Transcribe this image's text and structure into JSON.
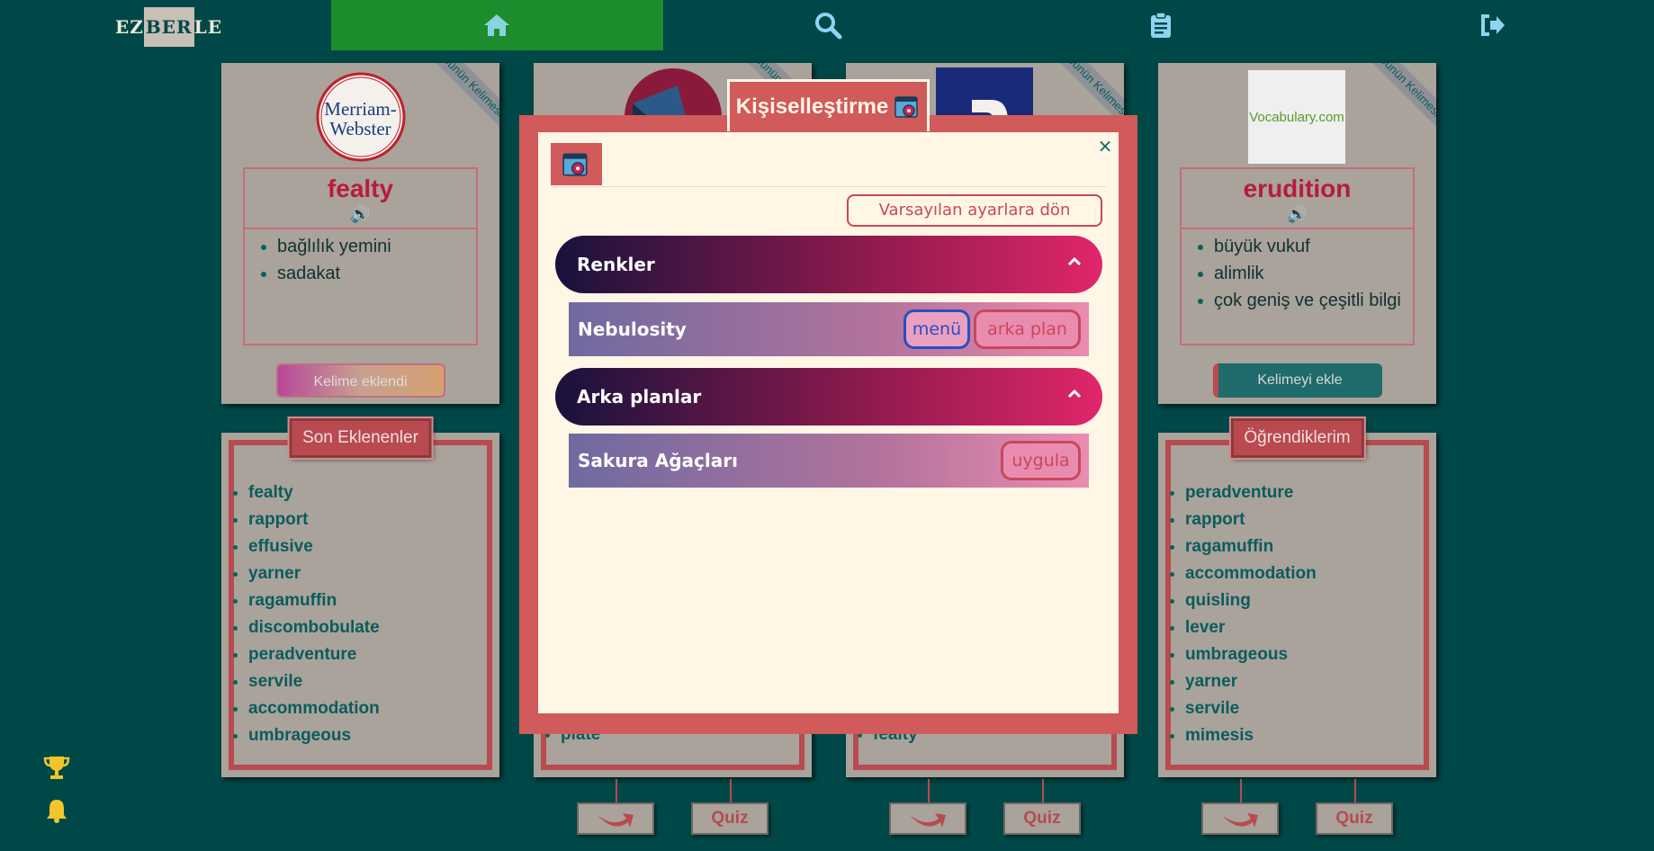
{
  "nav": {
    "logo_left": "EZ",
    "logo_mid": "BER",
    "logo_right": "LE",
    "items": [
      {
        "icon": "home-icon"
      },
      {
        "icon": "search-icon"
      },
      {
        "icon": "clipboard-icon"
      },
      {
        "icon": "sign-out-icon"
      }
    ]
  },
  "cards": {
    "ribbon": "Günün Kelimesi",
    "card1": {
      "logo_text_1": "Merriam-",
      "logo_text_2": "Webster",
      "word": "fealty",
      "definitions": [
        "bağlılık yemini",
        "sadakat"
      ],
      "button": "Kelime eklendi"
    },
    "card4": {
      "logo_text": "Vocabulary.com",
      "word": "erudition",
      "definitions": [
        "büyük vukuf",
        "alimlik",
        "çok geniş ve çeşitli bilgi"
      ],
      "button": "Kelimeyi ekle"
    }
  },
  "panels": {
    "recent": {
      "title": "Son Eklenenler",
      "items": [
        "fealty",
        "rapport",
        "effusive",
        "yarner",
        "ragamuffin",
        "discombobulate",
        "peradventure",
        "servile",
        "accommodation",
        "umbrageous"
      ]
    },
    "middle_left_last": "plate",
    "middle_right_last": "fealty",
    "learned": {
      "title": "Öğrendiklerim",
      "items": [
        "peradventure",
        "rapport",
        "ragamuffin",
        "accommodation",
        "quisling",
        "lever",
        "umbrageous",
        "yarner",
        "servile",
        "mimesis"
      ]
    }
  },
  "bottom": {
    "quiz_label": "Quiz"
  },
  "side_icons": [
    "trophy-icon",
    "bell-icon"
  ],
  "modal": {
    "title": "Kişiselleştirme",
    "close": "×",
    "reset_button": "Varsayılan ayarlara dön",
    "colors_section": {
      "title": "Renkler",
      "theme_name": "Nebulosity",
      "menu_button": "menü",
      "background_button": "arka plan"
    },
    "backgrounds_section": {
      "title": "Arka planlar",
      "bg_name": "Sakura Ağaçları",
      "apply_button": "uygula"
    }
  },
  "colors": {
    "page_bg": "#004848",
    "accent_red": "#d15a5a",
    "nav_active": "#1c8c2c",
    "word_red": "#b81c3c"
  }
}
